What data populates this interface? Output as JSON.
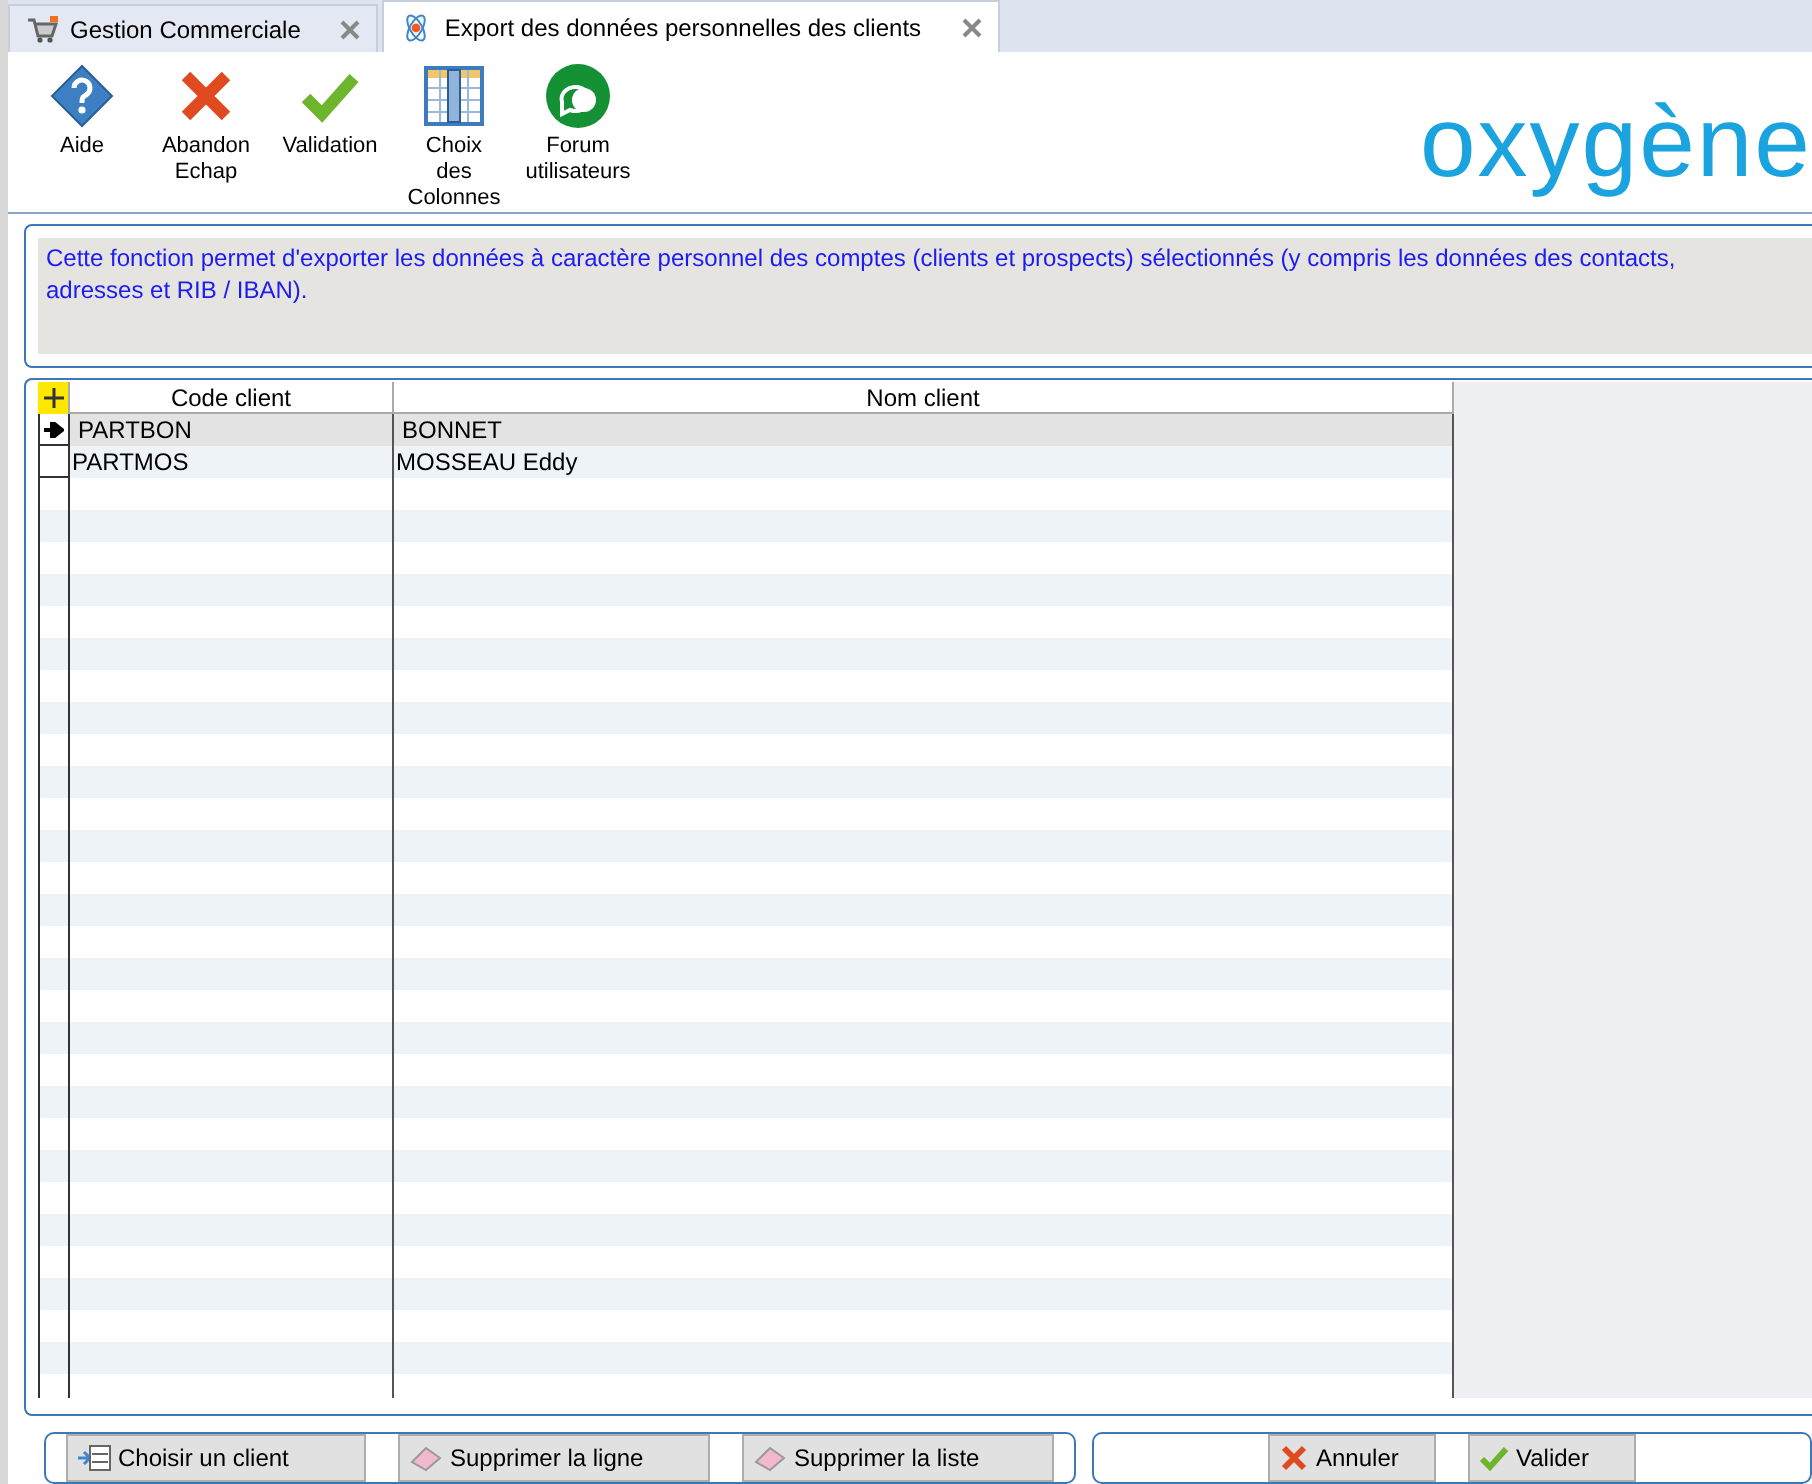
{
  "tabs": [
    {
      "label": "Gestion Commerciale",
      "kind": "cart",
      "selected": false
    },
    {
      "label": "Export des données personnelles des clients",
      "kind": "atom",
      "selected": true
    }
  ],
  "toolbar": [
    {
      "label": "Aide",
      "kind": "help"
    },
    {
      "label": "Abandon\nEchap",
      "kind": "cancel"
    },
    {
      "label": "Validation",
      "kind": "ok"
    },
    {
      "label": "Choix\ndes\nColonnes",
      "kind": "columns"
    },
    {
      "label": "Forum\nutilisateurs",
      "kind": "forum"
    }
  ],
  "logo": "oxygène",
  "info": "Cette fonction permet d'exporter les données à caractère personnel des comptes (clients et prospects) sélectionnés (y compris les données des contacts, adresses et RIB / IBAN).",
  "table": {
    "columns": [
      "Code client",
      "Nom client"
    ],
    "rows": [
      {
        "cells": [
          "PARTBON",
          "BONNET"
        ],
        "selected": true
      },
      {
        "cells": [
          "PARTMOS",
          "MOSSEAU Eddy"
        ],
        "selected": false
      }
    ]
  },
  "list_buttons": [
    {
      "label": "Choisir un client",
      "kind": "pick"
    },
    {
      "label": "Supprimer la ligne",
      "kind": "erase"
    },
    {
      "label": "Supprimer la liste",
      "kind": "erase"
    }
  ],
  "dialog_buttons": [
    {
      "label": "Annuler",
      "kind": "cancel"
    },
    {
      "label": "Valider",
      "kind": "ok"
    }
  ]
}
